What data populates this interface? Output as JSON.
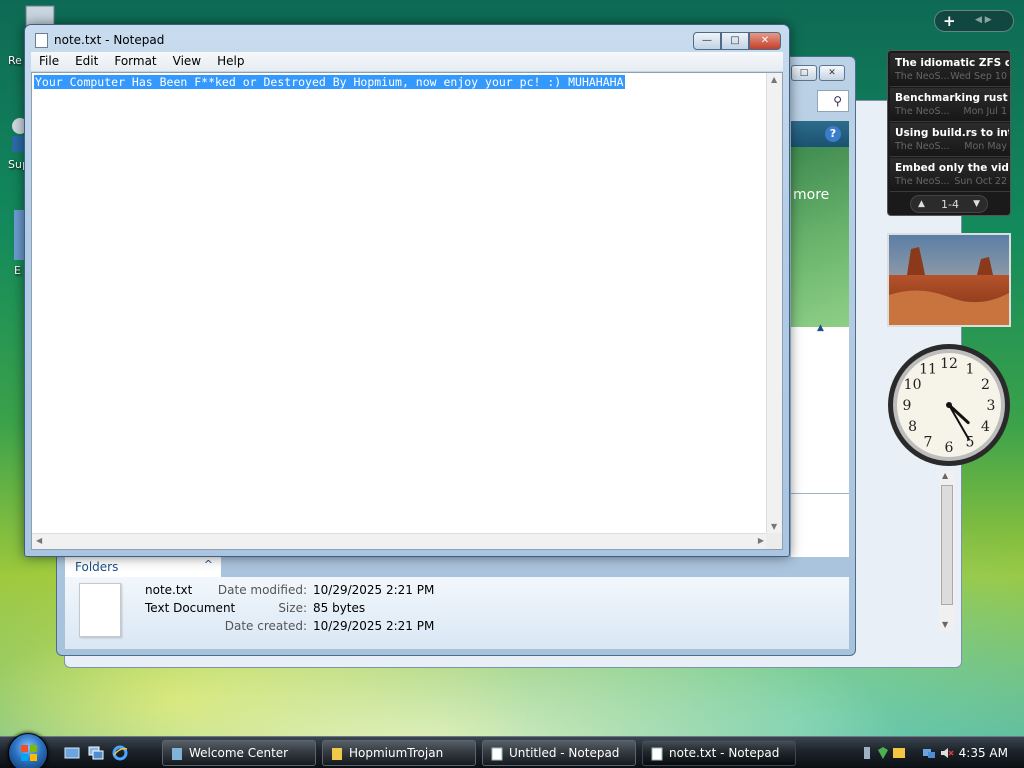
{
  "desktop": {
    "icon_labels": [
      "Re",
      "Sup",
      "E"
    ]
  },
  "explorer": {
    "folders_label": "Folders",
    "more_text": "more",
    "details": {
      "name": "note.txt",
      "type": "Text Document",
      "modified_label": "Date modified:",
      "modified_value": "10/29/2025 2:21 PM",
      "size_label": "Size:",
      "size_value": "85 bytes",
      "created_label": "Date created:",
      "created_value": "10/29/2025 2:21 PM"
    }
  },
  "notepad": {
    "title": "note.txt - Notepad",
    "menu": [
      "File",
      "Edit",
      "Format",
      "View",
      "Help"
    ],
    "content": "Your Computer Has Been F**ked or Destroyed By Hopmium, now enjoy your pc! :) MUHAHAHA"
  },
  "sidebar": {
    "feeds": [
      {
        "title": "The idiomatic ZFS on...",
        "source": "The NeoS...",
        "date": "Wed Sep 10"
      },
      {
        "title": "Benchmarking rust c...",
        "source": "The NeoS...",
        "date": "Mon Jul 1"
      },
      {
        "title": "Using build.rs to inte...",
        "source": "The NeoS...",
        "date": "Mon May"
      },
      {
        "title": "Embed only the vide...",
        "source": "The NeoS...",
        "date": "Sun Oct 22"
      }
    ],
    "pager": "1-4",
    "clock_hour": 4,
    "clock_minute": 25
  },
  "taskbar": {
    "tasks": [
      "Welcome Center",
      "HopmiumTrojan",
      "Untitled - Notepad",
      "note.txt - Notepad"
    ],
    "time": "4:35 AM"
  },
  "colors": {
    "selection": "#3399ff",
    "accent": "#1b4f8a"
  }
}
